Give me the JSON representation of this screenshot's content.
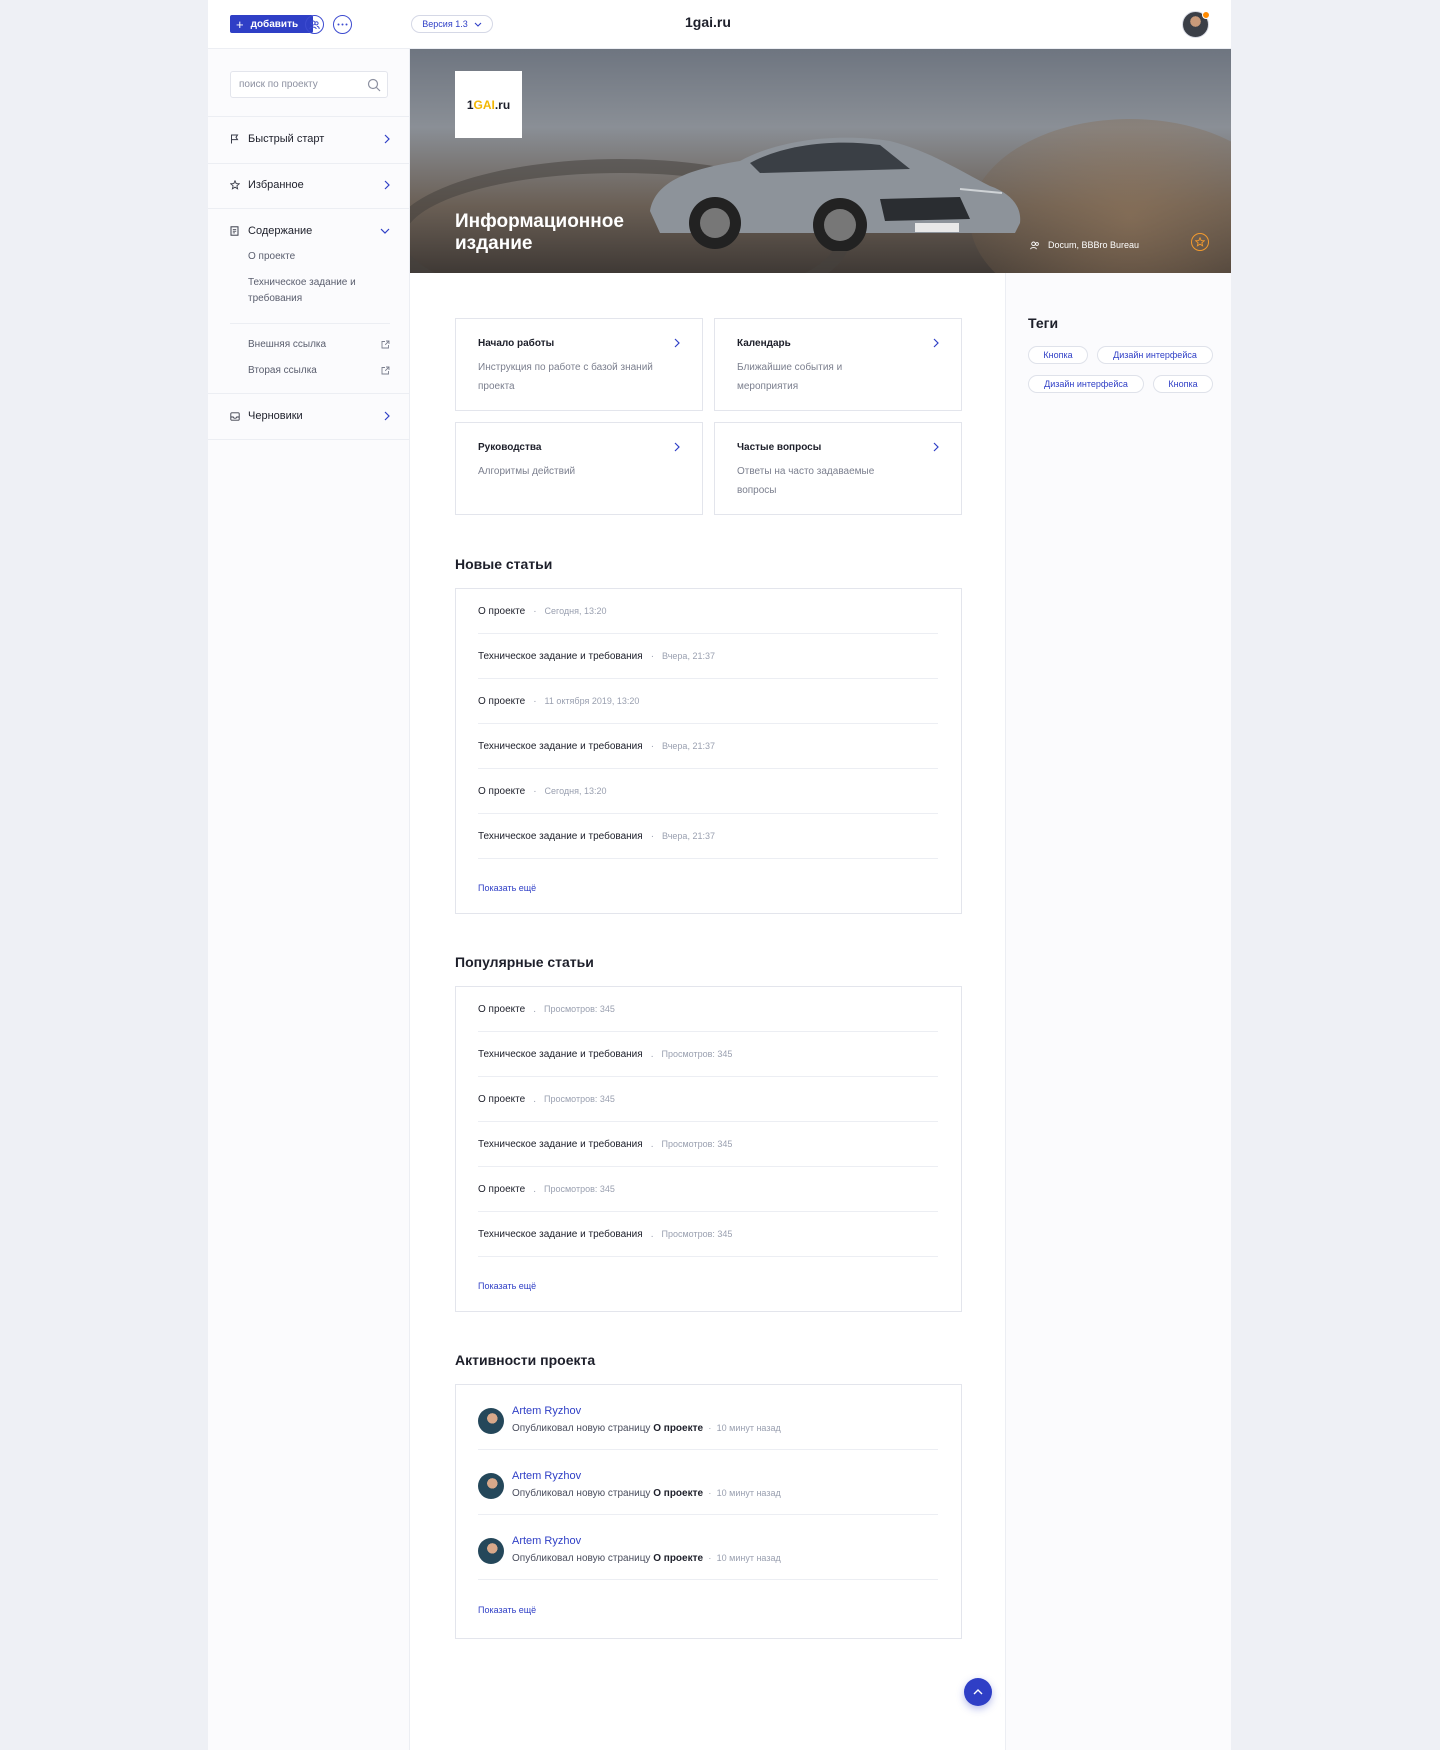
{
  "topbar": {
    "add_label": "добавить",
    "version_label": "Версия 1.3",
    "site_title": "1gai.ru"
  },
  "sidebar": {
    "search_placeholder": "поиск по проекту",
    "items": [
      {
        "label": "Быстрый старт",
        "icon": "flag-icon"
      },
      {
        "label": "Избранное",
        "icon": "star-icon"
      },
      {
        "label": "Содержание",
        "icon": "document-icon"
      },
      {
        "label": "Черновики",
        "icon": "inbox-icon"
      }
    ],
    "sub_items": [
      "О проекте",
      "Техническое задание и требования"
    ],
    "links": [
      "Внешняя ссылка",
      "Вторая ссылка"
    ]
  },
  "hero": {
    "logo_prefix": "1",
    "logo_accent": "GAI",
    "logo_suffix": ".ru",
    "title": "Информационное издание",
    "author": "Docum, BBBro Bureau"
  },
  "cards": [
    {
      "title": "Начало работы",
      "desc": "Инструкция по работе с базой знаний проекта"
    },
    {
      "title": "Календарь",
      "desc": "Ближайшие события и мероприятия"
    },
    {
      "title": "Руководства",
      "desc": "Алгоритмы действий"
    },
    {
      "title": "Частые вопросы",
      "desc": "Ответы на часто задаваемые вопросы"
    }
  ],
  "new_articles": {
    "title": "Новые статьи",
    "rows": [
      {
        "title": "О проекте",
        "meta": "Сегодня, 13:20"
      },
      {
        "title": "Техническое задание и требования",
        "meta": "Вчера, 21:37"
      },
      {
        "title": "О проекте",
        "meta": "11 октября 2019, 13:20"
      },
      {
        "title": "Техническое задание и требования",
        "meta": "Вчера, 21:37"
      },
      {
        "title": "О проекте",
        "meta": "Сегодня, 13:20"
      },
      {
        "title": "Техническое задание и требования",
        "meta": "Вчера, 21:37"
      }
    ],
    "more": "Показать ещё"
  },
  "popular_articles": {
    "title": "Популярные статьи",
    "rows": [
      {
        "title": "О проекте",
        "meta": "Просмотров: 345"
      },
      {
        "title": "Техническое задание и требования",
        "meta": "Просмотров: 345"
      },
      {
        "title": "О проекте",
        "meta": "Просмотров: 345"
      },
      {
        "title": "Техническое задание и требования",
        "meta": "Просмотров: 345"
      },
      {
        "title": "О проекте",
        "meta": "Просмотров: 345"
      },
      {
        "title": "Техническое задание и требования",
        "meta": "Просмотров: 345"
      }
    ],
    "more": "Показать ещё"
  },
  "activity": {
    "title": "Активности проекта",
    "rows": [
      {
        "name": "Artem Ryzhov",
        "action": "Опубликовал новую страницу",
        "page": "О проекте",
        "time": "10 минут назад"
      },
      {
        "name": "Artem Ryzhov",
        "action": "Опубликовал новую страницу",
        "page": "О проекте",
        "time": "10 минут назад"
      },
      {
        "name": "Artem Ryzhov",
        "action": "Опубликовал новую страницу",
        "page": "О проекте",
        "time": "10 минут назад"
      }
    ],
    "more": "Показать ещё"
  },
  "tags": {
    "title": "Теги",
    "items": [
      "Кнопка",
      "Дизайн интерфейса",
      "Дизайн интерфейса",
      "Кнопка"
    ]
  },
  "colors": {
    "accent": "#2f3fc6",
    "badge": "#ff8a00",
    "star": "#f29a2e"
  }
}
